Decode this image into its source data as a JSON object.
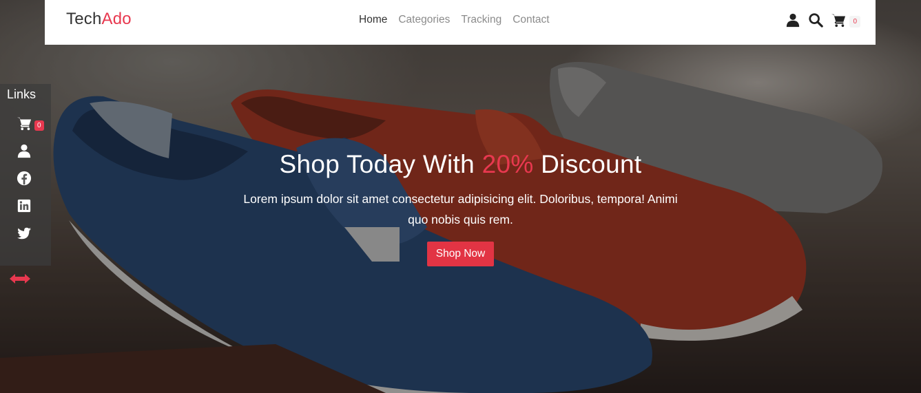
{
  "brand": {
    "name_part1": "Tech",
    "name_part2": "Ado"
  },
  "nav": {
    "links": [
      {
        "label": "Home",
        "active": true
      },
      {
        "label": "Categories",
        "active": false
      },
      {
        "label": "Tracking",
        "active": false
      },
      {
        "label": "Contact",
        "active": false
      }
    ],
    "icons": [
      "user-icon",
      "search-icon",
      "cart-icon"
    ],
    "cart_count": "0"
  },
  "side_panel": {
    "title": "Links",
    "items": [
      "cart-icon",
      "user-icon",
      "facebook-icon",
      "linkedin-icon",
      "twitter-icon"
    ],
    "cart_count": "0",
    "toggle_icon": "double-arrow-icon"
  },
  "hero": {
    "title_part1": "Shop Today With ",
    "title_highlight": "20%",
    "title_part2": " Discount",
    "text": "Lorem ipsum dolor sit amet consectetur adipisicing elit. Doloribus, tempora! Animi quo nobis quis rem.",
    "button_label": "Shop Now"
  },
  "colors": {
    "accent": "#e8384f",
    "button": "#e23444",
    "nav_bg": "#ffffff",
    "text_dark": "#333333"
  }
}
